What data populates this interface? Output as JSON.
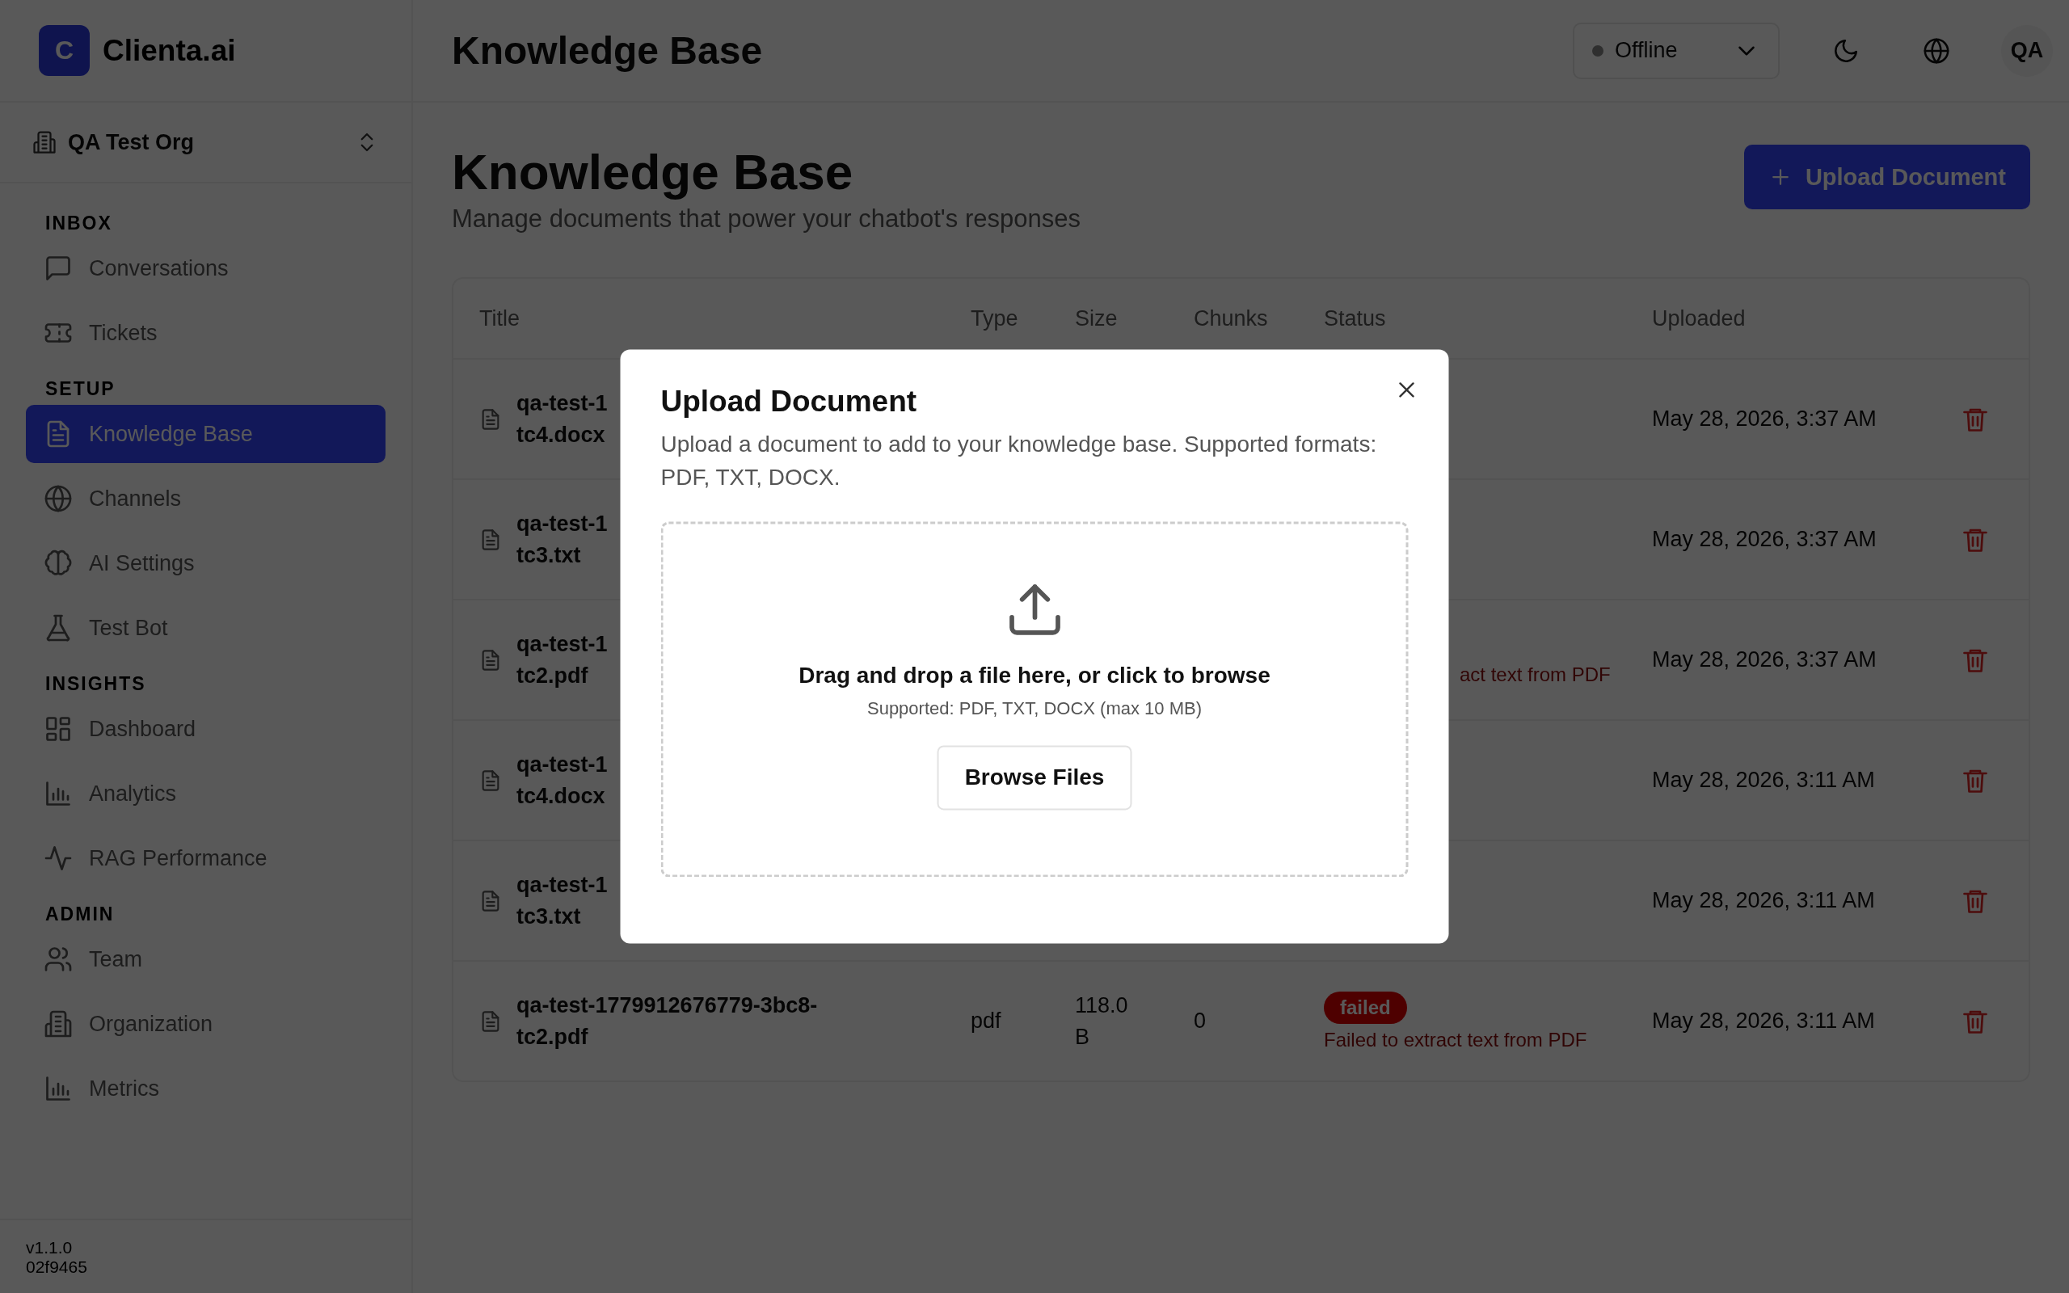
{
  "brand": {
    "logo_letter": "C",
    "name": "Clienta.ai"
  },
  "org_switcher": {
    "name": "QA Test Org"
  },
  "sidebar": {
    "sections": [
      {
        "label": "INBOX",
        "items": [
          {
            "label": "Conversations",
            "selected": false
          },
          {
            "label": "Tickets",
            "selected": false
          }
        ]
      },
      {
        "label": "SETUP",
        "items": [
          {
            "label": "Knowledge Base",
            "selected": true
          },
          {
            "label": "Channels",
            "selected": false
          },
          {
            "label": "AI Settings",
            "selected": false
          },
          {
            "label": "Test Bot",
            "selected": false
          }
        ]
      },
      {
        "label": "INSIGHTS",
        "items": [
          {
            "label": "Dashboard",
            "selected": false
          },
          {
            "label": "Analytics",
            "selected": false
          },
          {
            "label": "RAG Performance",
            "selected": false
          }
        ]
      },
      {
        "label": "ADMIN",
        "items": [
          {
            "label": "Team",
            "selected": false
          },
          {
            "label": "Organization",
            "selected": false
          },
          {
            "label": "Metrics",
            "selected": false
          }
        ]
      }
    ]
  },
  "version": {
    "number": "v1.1.0",
    "commit": "02f9465"
  },
  "header": {
    "title": "Knowledge Base",
    "status_select": {
      "value": "Offline"
    },
    "avatar": "QA"
  },
  "page": {
    "title": "Knowledge Base",
    "subtitle": "Manage documents that power your chatbot's responses",
    "upload_button": "Upload Document"
  },
  "table": {
    "columns": [
      "Title",
      "Type",
      "Size",
      "Chunks",
      "Status",
      "Uploaded"
    ],
    "rows": [
      {
        "title_lines": [
          "qa-test-1",
          "tc4.docx"
        ],
        "uploaded": "May 28, 2026, 3:37 AM"
      },
      {
        "title_lines": [
          "qa-test-1",
          "tc3.txt"
        ],
        "uploaded": "May 28, 2026, 3:37 AM"
      },
      {
        "title_lines": [
          "qa-test-1",
          "tc2.pdf"
        ],
        "status": {
          "message": "act text from PDF",
          "clipped": true
        },
        "uploaded": "May 28, 2026, 3:37 AM"
      },
      {
        "title_lines": [
          "qa-test-1",
          "tc4.docx"
        ],
        "uploaded": "May 28, 2026, 3:11 AM"
      },
      {
        "title_lines": [
          "qa-test-1",
          "tc3.txt"
        ],
        "uploaded": "May 28, 2026, 3:11 AM"
      },
      {
        "title": "qa-test-1779912676779-3bc8-tc2.pdf",
        "type": "pdf",
        "size": "118.0 B",
        "chunks": "0",
        "status": {
          "badge": "failed",
          "message": "Failed to extract text from PDF"
        },
        "uploaded": "May 28, 2026, 3:11 AM"
      }
    ]
  },
  "dialog": {
    "title": "Upload Document",
    "description": "Upload a document to add to your knowledge base. Supported formats: PDF, TXT, DOCX.",
    "drop_text": "Drag and drop a file here, or click to browse",
    "drop_hint": "Supported: PDF, TXT, DOCX (max 10 MB)",
    "browse_button": "Browse Files"
  }
}
